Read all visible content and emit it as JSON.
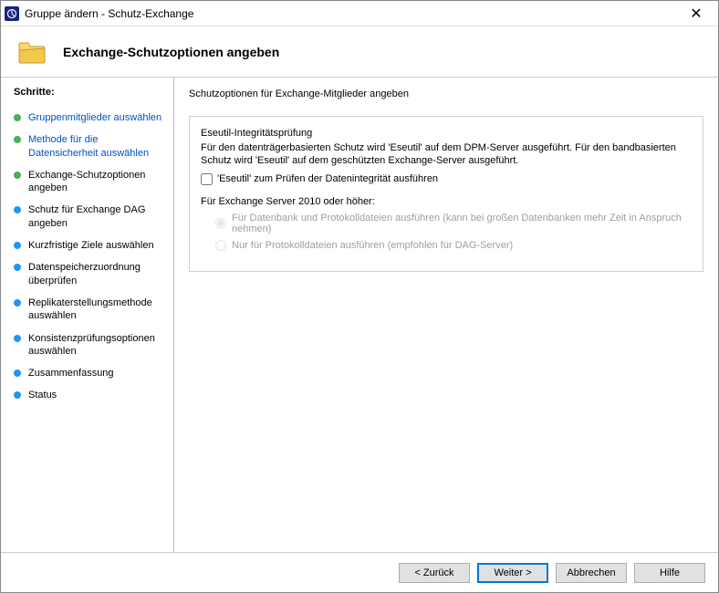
{
  "window": {
    "title": "Gruppe ändern - Schutz-Exchange"
  },
  "header": {
    "title": "Exchange-Schutzoptionen angeben"
  },
  "sidebar": {
    "heading": "Schritte:",
    "items": [
      {
        "label": "Gruppenmitglieder auswählen",
        "state": "done"
      },
      {
        "label": "Methode für die Datensicherheit auswählen",
        "state": "done"
      },
      {
        "label": "Exchange-Schutzoptionen angeben",
        "state": "current"
      },
      {
        "label": "Schutz für Exchange DAG angeben",
        "state": "pending"
      },
      {
        "label": "Kurzfristige Ziele auswählen",
        "state": "pending"
      },
      {
        "label": "Datenspeicherzuordnung überprüfen",
        "state": "pending"
      },
      {
        "label": "Replikaterstellungsmethode auswählen",
        "state": "pending"
      },
      {
        "label": "Konsistenzprüfungsoptionen auswählen",
        "state": "pending"
      },
      {
        "label": "Zusammenfassung",
        "state": "pending"
      },
      {
        "label": "Status",
        "state": "pending"
      }
    ]
  },
  "main": {
    "intro": "Schutzoptionen für Exchange-Mitglieder angeben",
    "eseutil": {
      "heading": "Eseutil-Integritätsprüfung",
      "desc": "Für den datenträgerbasierten Schutz wird 'Eseutil' auf dem DPM-Server ausgeführt. Für den bandbasierten Schutz wird 'Eseutil' auf dem geschützten Exchange-Server ausgeführt.",
      "checkbox_label": "'Eseutil' zum Prüfen der Datenintegrität ausführen",
      "checkbox_checked": false
    },
    "exchange2010": {
      "heading": "Für Exchange Server 2010 oder höher:",
      "radio1": "Für Datenbank und Protokolldateien ausführen (kann bei großen Datenbanken mehr Zeit in Anspruch nehmen)",
      "radio2": "Nur für Protokolldateien ausführen (empfohlen für DAG-Server)"
    }
  },
  "buttons": {
    "back": "< Zurück",
    "next": "Weiter >",
    "cancel": "Abbrechen",
    "help": "Hilfe"
  }
}
